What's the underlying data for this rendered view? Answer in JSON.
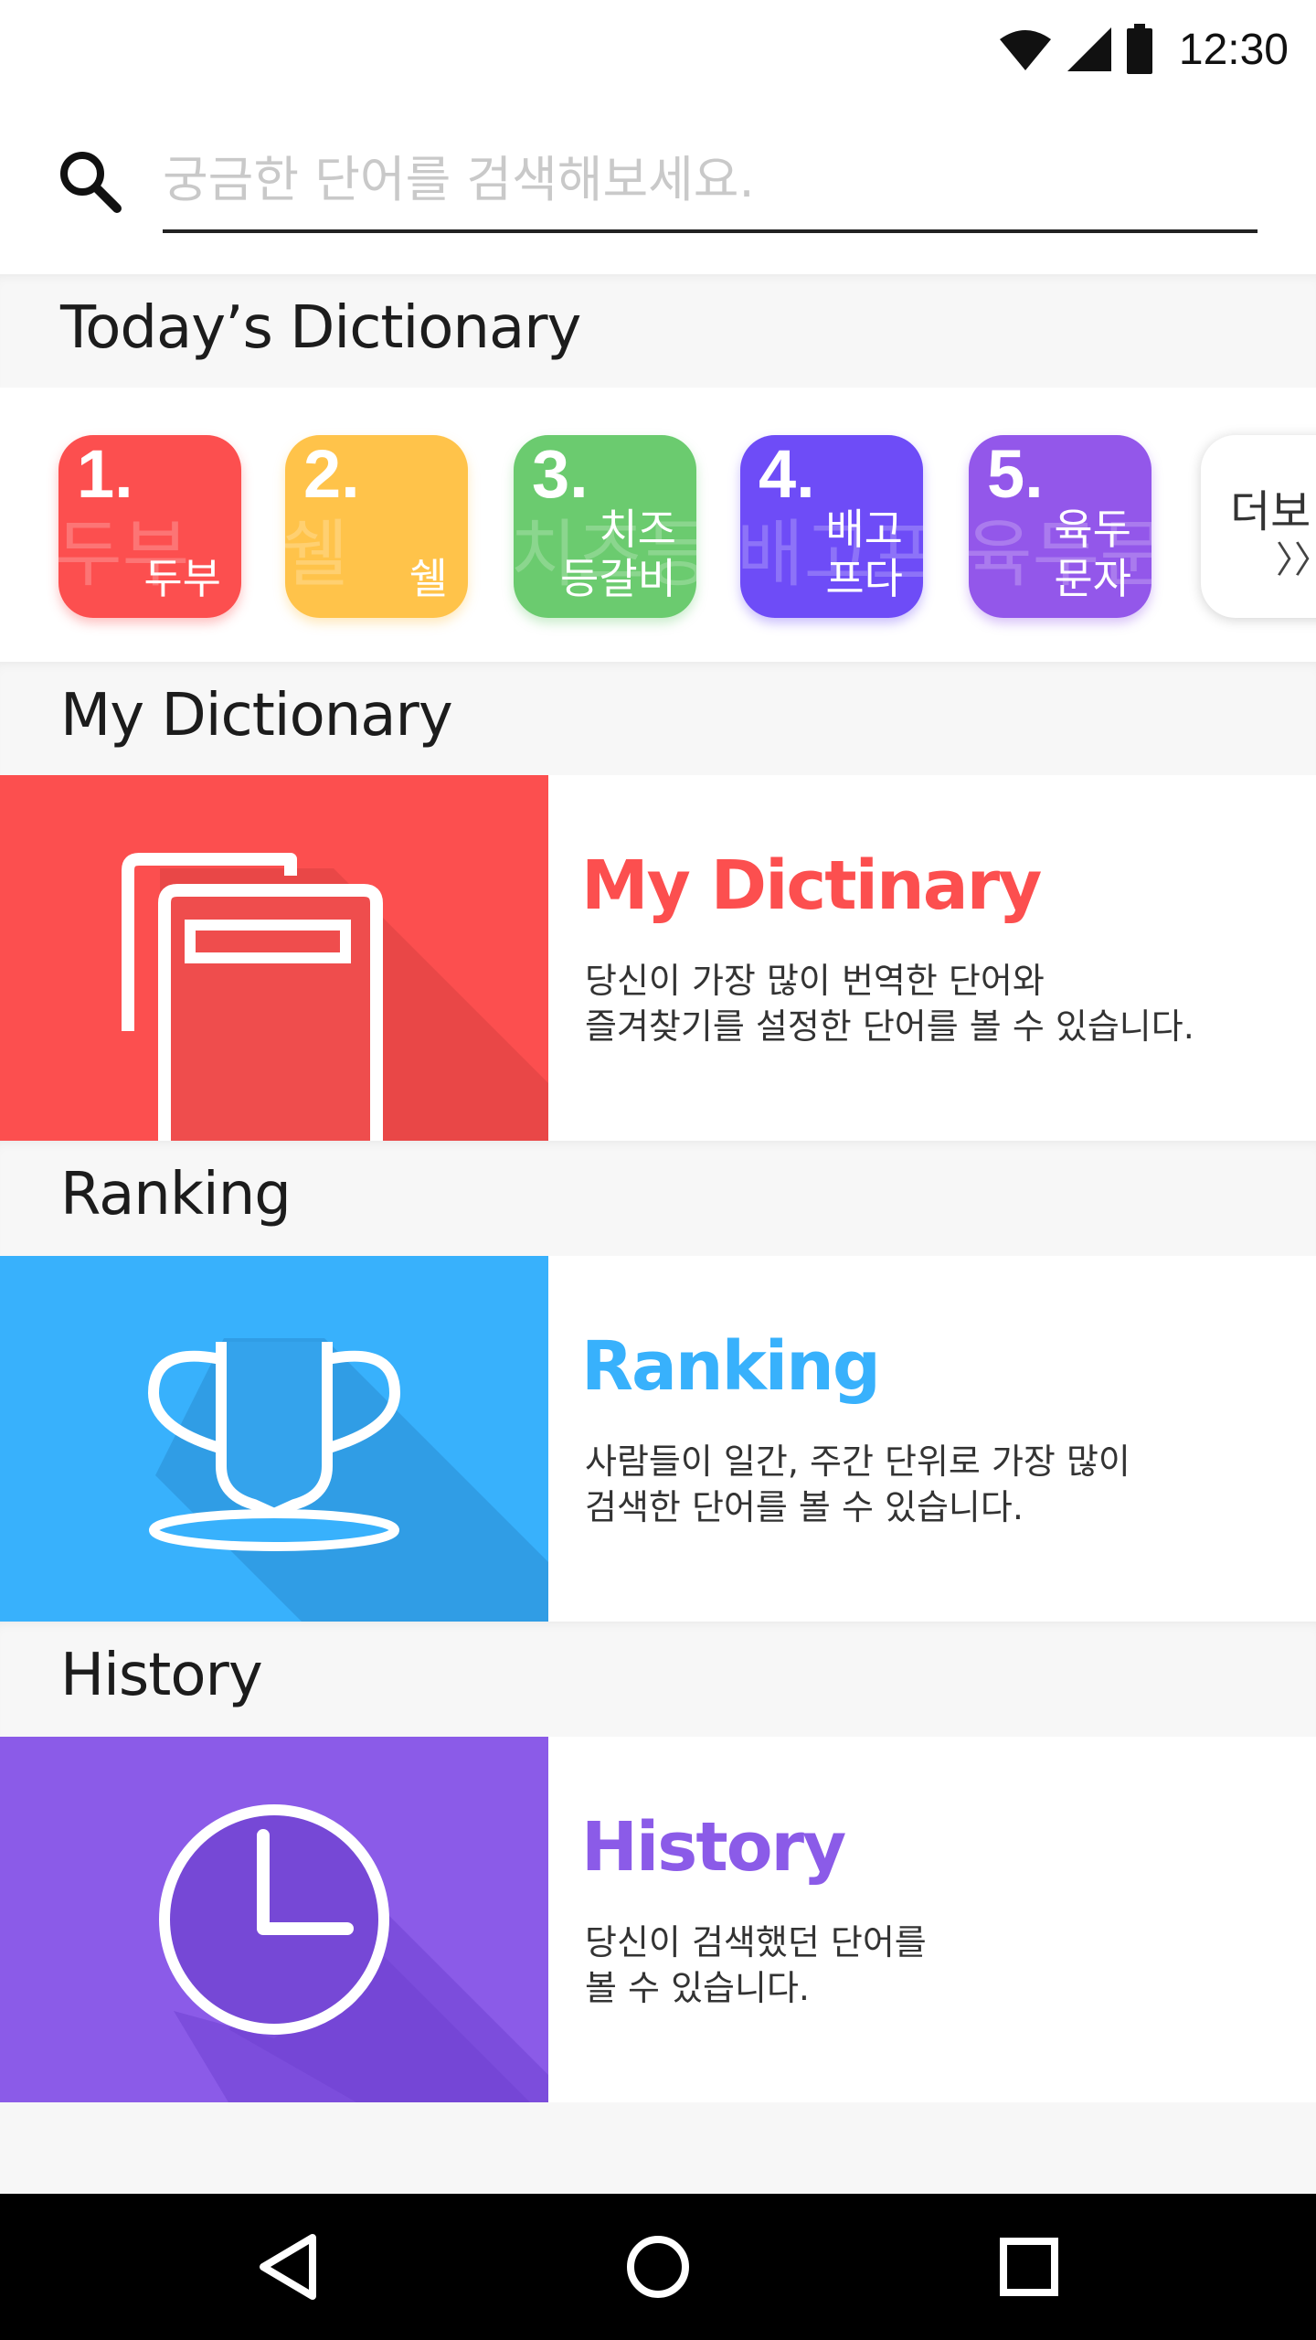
{
  "status_bar": {
    "time": "12:30",
    "icons": [
      "wifi-icon",
      "signal-icon",
      "battery-icon"
    ]
  },
  "search": {
    "placeholder": "궁금한 단어를 검색해보세요.",
    "value": ""
  },
  "sections": {
    "today": "Today’s Dictionary",
    "my_dictionary": "My Dictionary",
    "ranking": "Ranking",
    "history": "History"
  },
  "today_words": [
    {
      "rank": "1.",
      "word": "두부",
      "ghost": "두부",
      "color": "#fc4f4f"
    },
    {
      "rank": "2.",
      "word": "쉘",
      "ghost": "쉘",
      "color": "#ffc34a"
    },
    {
      "rank": "3.",
      "word": "치즈\n등갈비",
      "ghost": "치즈등",
      "color": "#6bcb6f"
    },
    {
      "rank": "4.",
      "word": "배고\n프다",
      "ghost": "배고프",
      "color": "#6e4cf7"
    },
    {
      "rank": "5.",
      "word": "육두\n문자",
      "ghost": "육두문",
      "color": "#9357ea"
    }
  ],
  "more": {
    "label": "더보",
    "arrows": "〉〉"
  },
  "features": {
    "my_dictionary": {
      "title": "My Dictinary",
      "desc": "당신이 가장 많이 번역한 단어와\n즐겨찾기를 설정한 단어를 볼 수 있습니다.",
      "color": "#fc4f4f",
      "icon": "book-icon"
    },
    "ranking": {
      "title": "Ranking",
      "desc": "사람들이 일간, 주간 단위로 가장 많이\n검색한 단어를 볼 수 있습니다.",
      "color": "#38b1fc",
      "icon": "trophy-icon"
    },
    "history": {
      "title": "History",
      "desc": "당신이 검색했던 단어를\n볼 수 있습니다.",
      "color": "#8b5be8",
      "icon": "clock-icon"
    }
  },
  "nav": [
    "back-icon",
    "home-icon",
    "recents-icon"
  ]
}
